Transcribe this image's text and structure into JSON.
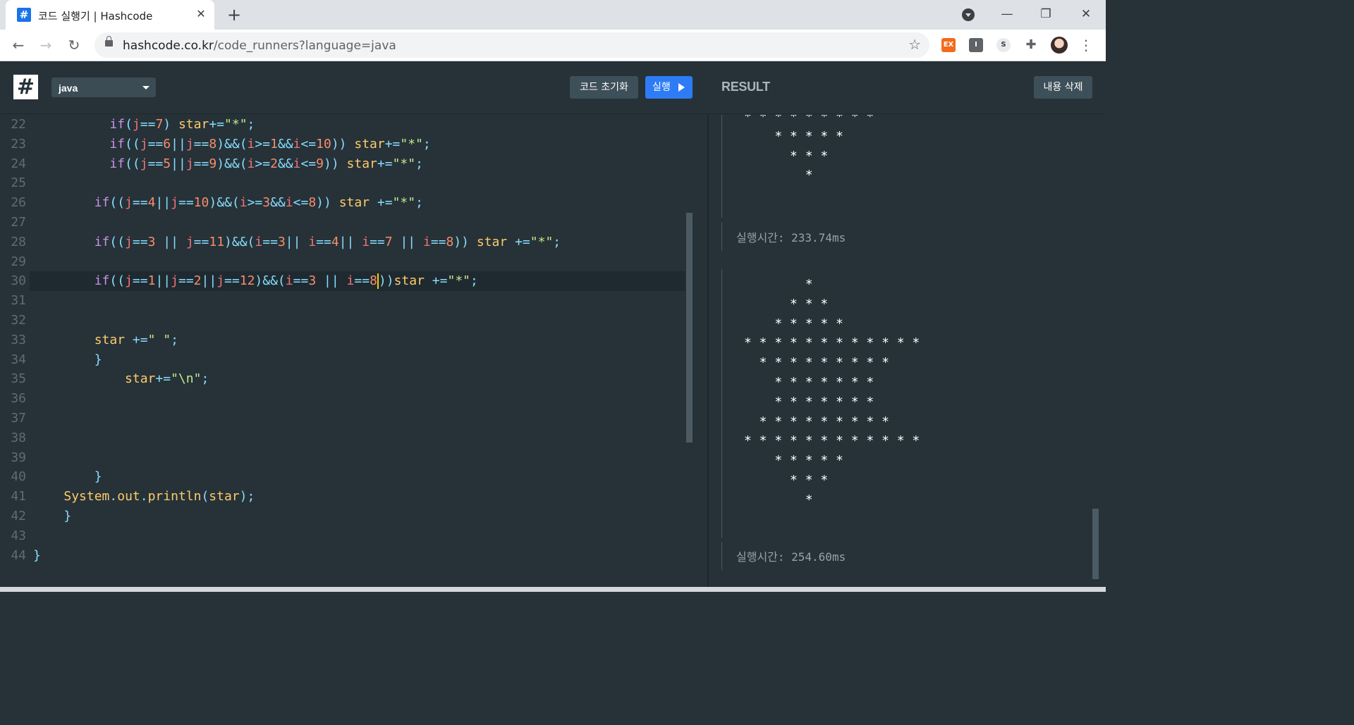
{
  "browser": {
    "tab_title": "코드 실행기 | Hashcode",
    "tab_favicon": "#",
    "tab_close": "✕",
    "new_tab": "+",
    "url_host": "hashcode.co.kr",
    "url_path": "/code_runners?language=java",
    "win_minimize": "—",
    "win_restore": "❐",
    "win_close": "✕",
    "ext_ex": "EX",
    "ext_i": "I",
    "ext_s": "S"
  },
  "app": {
    "logo": "#",
    "language": "java",
    "reset_label": "코드 초기화",
    "run_label": "실행",
    "result_title": "RESULT",
    "clear_label": "내용 삭제"
  },
  "editor": {
    "lines": [
      {
        "n": "22",
        "code": "          if(j==7) star+=\"*\";"
      },
      {
        "n": "23",
        "code": "          if((j==6||j==8)&&(i>=1&&i<=10)) star+=\"*\";"
      },
      {
        "n": "24",
        "code": "          if((j==5||j==9)&&(i>=2&&i<=9)) star+=\"*\";"
      },
      {
        "n": "25",
        "code": ""
      },
      {
        "n": "26",
        "code": "        if((j==4||j==10)&&(i>=3&&i<=8)) star +=\"*\";"
      },
      {
        "n": "27",
        "code": ""
      },
      {
        "n": "28",
        "code": "        if((j==3 || j==11)&&(i==3|| i==4|| i==7 || i==8)) star +=\"*\";"
      },
      {
        "n": "29",
        "code": ""
      },
      {
        "n": "30",
        "code": "        if((j==1||j==2||j==12)&&(i==3 || i==8))star +=\"*\";"
      },
      {
        "n": "31",
        "code": ""
      },
      {
        "n": "32",
        "code": ""
      },
      {
        "n": "33",
        "code": "        star +=\" \";"
      },
      {
        "n": "34",
        "code": "        }"
      },
      {
        "n": "35",
        "code": "            star+=\"\\n\";"
      },
      {
        "n": "36",
        "code": ""
      },
      {
        "n": "37",
        "code": ""
      },
      {
        "n": "38",
        "code": ""
      },
      {
        "n": "39",
        "code": ""
      },
      {
        "n": "40",
        "code": "        }"
      },
      {
        "n": "41",
        "code": "    System.out.println(star);"
      },
      {
        "n": "42",
        "code": "    }"
      },
      {
        "n": "43",
        "code": ""
      },
      {
        "n": "44",
        "code": "}"
      }
    ]
  },
  "result": {
    "runs": [
      {
        "output": [
          "* * * * * * * * *",
          "    * * * * *",
          "      * * *",
          "        *"
        ],
        "runtime": "실행시간: 233.74ms"
      },
      {
        "output": [
          "        *",
          "      * * *",
          "    * * * * *",
          "* * * * * * * * * * * *",
          "  * * * * * * * * *",
          "    * * * * * * *",
          "    * * * * * * *",
          "  * * * * * * * * *",
          "* * * * * * * * * * * *",
          "    * * * * *",
          "      * * *",
          "        *"
        ],
        "runtime": "실행시간: 254.60ms"
      }
    ]
  }
}
